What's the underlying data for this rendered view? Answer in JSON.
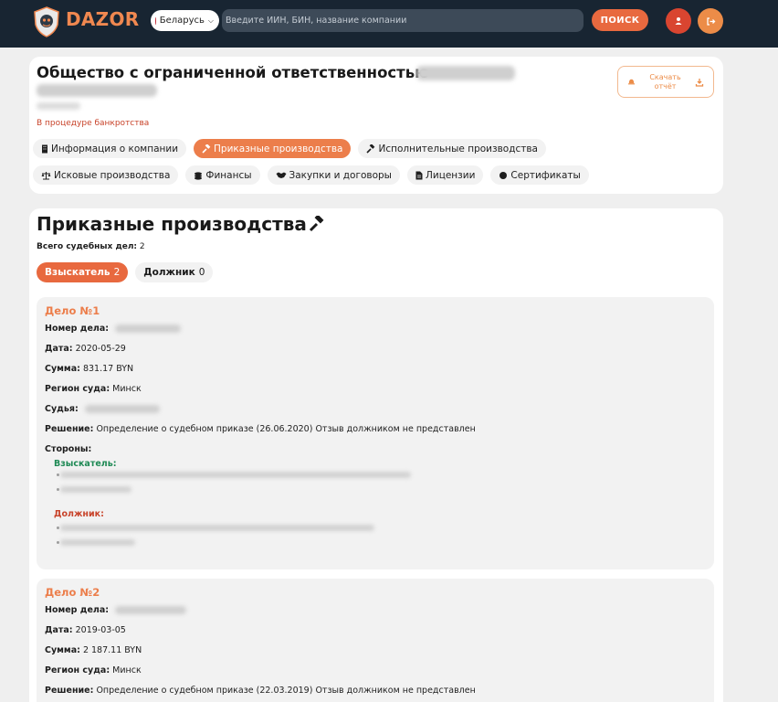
{
  "header": {
    "logo_text": "DAZOR",
    "country": "Беларусь",
    "search_placeholder": "Введите ИИН, БИН, название компании",
    "search_button": "ПОИСК"
  },
  "company": {
    "title": "Общество с ограниченной ответственностью",
    "status": "В процедуре банкротства",
    "report_button": "Скачать отчёт",
    "tabs_row1": [
      {
        "label": "Информация о компании",
        "icon": "building-icon",
        "active": false
      },
      {
        "label": "Приказные производства",
        "icon": "gavel-icon",
        "active": true
      },
      {
        "label": "Исполнительные производства",
        "icon": "hammer-icon",
        "active": false
      }
    ],
    "tabs_row2": [
      {
        "label": "Исковые производства",
        "icon": "scales-icon",
        "active": false
      },
      {
        "label": "Финансы",
        "icon": "coins-icon",
        "active": false
      },
      {
        "label": "Закупки и договоры",
        "icon": "handshake-icon",
        "active": false
      },
      {
        "label": "Лицензии",
        "icon": "document-icon",
        "active": false
      },
      {
        "label": "Сертификаты",
        "icon": "certificate-icon",
        "active": false
      }
    ]
  },
  "main": {
    "section_title": "Приказные производства",
    "total_label": "Всего судебных дел:",
    "total_value": "2",
    "role_tabs": [
      {
        "label": "Взыскатель",
        "count": "2",
        "active": true
      },
      {
        "label": "Должник",
        "count": "0",
        "active": false
      }
    ],
    "cases": [
      {
        "title": "Дело №1",
        "number_label": "Номер дела:",
        "date_label": "Дата:",
        "date": "2020-05-29",
        "amount_label": "Сумма:",
        "amount": "831.17 BYN",
        "region_label": "Регион суда:",
        "region": "Минск",
        "judge_label": "Судья:",
        "decision_label": "Решение:",
        "decision": "Определение о судебном приказе (26.06.2020) Отзыв должником не представлен",
        "parties_label": "Стороны:",
        "plaintiff_label": "Взыскатель:",
        "debtor_label": "Должник:"
      },
      {
        "title": "Дело №2",
        "number_label": "Номер дела:",
        "date_label": "Дата:",
        "date": "2019-03-05",
        "amount_label": "Сумма:",
        "amount": "2 187.11 BYN",
        "region_label": "Регион суда:",
        "region": "Минск",
        "decision_label": "Решение:",
        "decision": "Определение о судебном приказе (22.03.2019) Отзыв должником не представлен"
      }
    ]
  },
  "colors": {
    "header_bg": "#182532",
    "accent": "#ec7e4b",
    "danger": "#d94530",
    "plaintiff": "#1f8a55",
    "debtor": "#c8432a"
  }
}
